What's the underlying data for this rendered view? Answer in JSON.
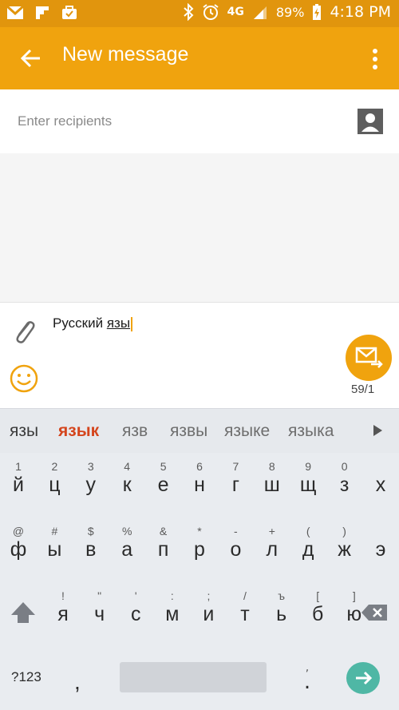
{
  "status_bar": {
    "icons": [
      "gmail-icon",
      "flipboard-icon",
      "briefcase-icon",
      "bluetooth-icon",
      "alarm-icon",
      "signal-icon",
      "battery-charging-icon"
    ],
    "network": "4G",
    "battery": "89%",
    "time": "4:18 PM"
  },
  "app_bar": {
    "title": "New message",
    "accent_color": "#f0a30e"
  },
  "recipients": {
    "placeholder": "Enter recipients"
  },
  "composer": {
    "text_plain": "Русский ",
    "text_underlined": "язы",
    "counter": "59/1"
  },
  "suggestions": [
    "язы",
    "язык",
    "язв",
    "язвы",
    "языке",
    "языка"
  ],
  "keyboard": {
    "row1": [
      {
        "hint": "1",
        "ch": "й"
      },
      {
        "hint": "2",
        "ch": "ц"
      },
      {
        "hint": "3",
        "ch": "у"
      },
      {
        "hint": "4",
        "ch": "к"
      },
      {
        "hint": "5",
        "ch": "е"
      },
      {
        "hint": "6",
        "ch": "н"
      },
      {
        "hint": "7",
        "ch": "г"
      },
      {
        "hint": "8",
        "ch": "ш"
      },
      {
        "hint": "9",
        "ch": "щ"
      },
      {
        "hint": "0",
        "ch": "з"
      },
      {
        "hint": "",
        "ch": "х"
      }
    ],
    "row2": [
      {
        "hint": "@",
        "ch": "ф"
      },
      {
        "hint": "#",
        "ch": "ы"
      },
      {
        "hint": "$",
        "ch": "в"
      },
      {
        "hint": "%",
        "ch": "а"
      },
      {
        "hint": "&",
        "ch": "п"
      },
      {
        "hint": "*",
        "ch": "р"
      },
      {
        "hint": "-",
        "ch": "о"
      },
      {
        "hint": "+",
        "ch": "л"
      },
      {
        "hint": "(",
        "ch": "д"
      },
      {
        "hint": ")",
        "ch": "ж"
      },
      {
        "hint": "",
        "ch": "э"
      }
    ],
    "row3": [
      {
        "hint": "!",
        "ch": "я"
      },
      {
        "hint": "\"",
        "ch": "ч"
      },
      {
        "hint": "'",
        "ch": "с"
      },
      {
        "hint": ":",
        "ch": "м"
      },
      {
        "hint": ";",
        "ch": "и"
      },
      {
        "hint": "/",
        "ch": "т"
      },
      {
        "hint": "ъ",
        "ch": "ь"
      },
      {
        "hint": "[",
        "ch": "б"
      },
      {
        "hint": "]",
        "ch": "ю"
      }
    ],
    "symbols_key": "?123",
    "comma_key": ",",
    "period_hint": ",",
    "period_key": "."
  }
}
